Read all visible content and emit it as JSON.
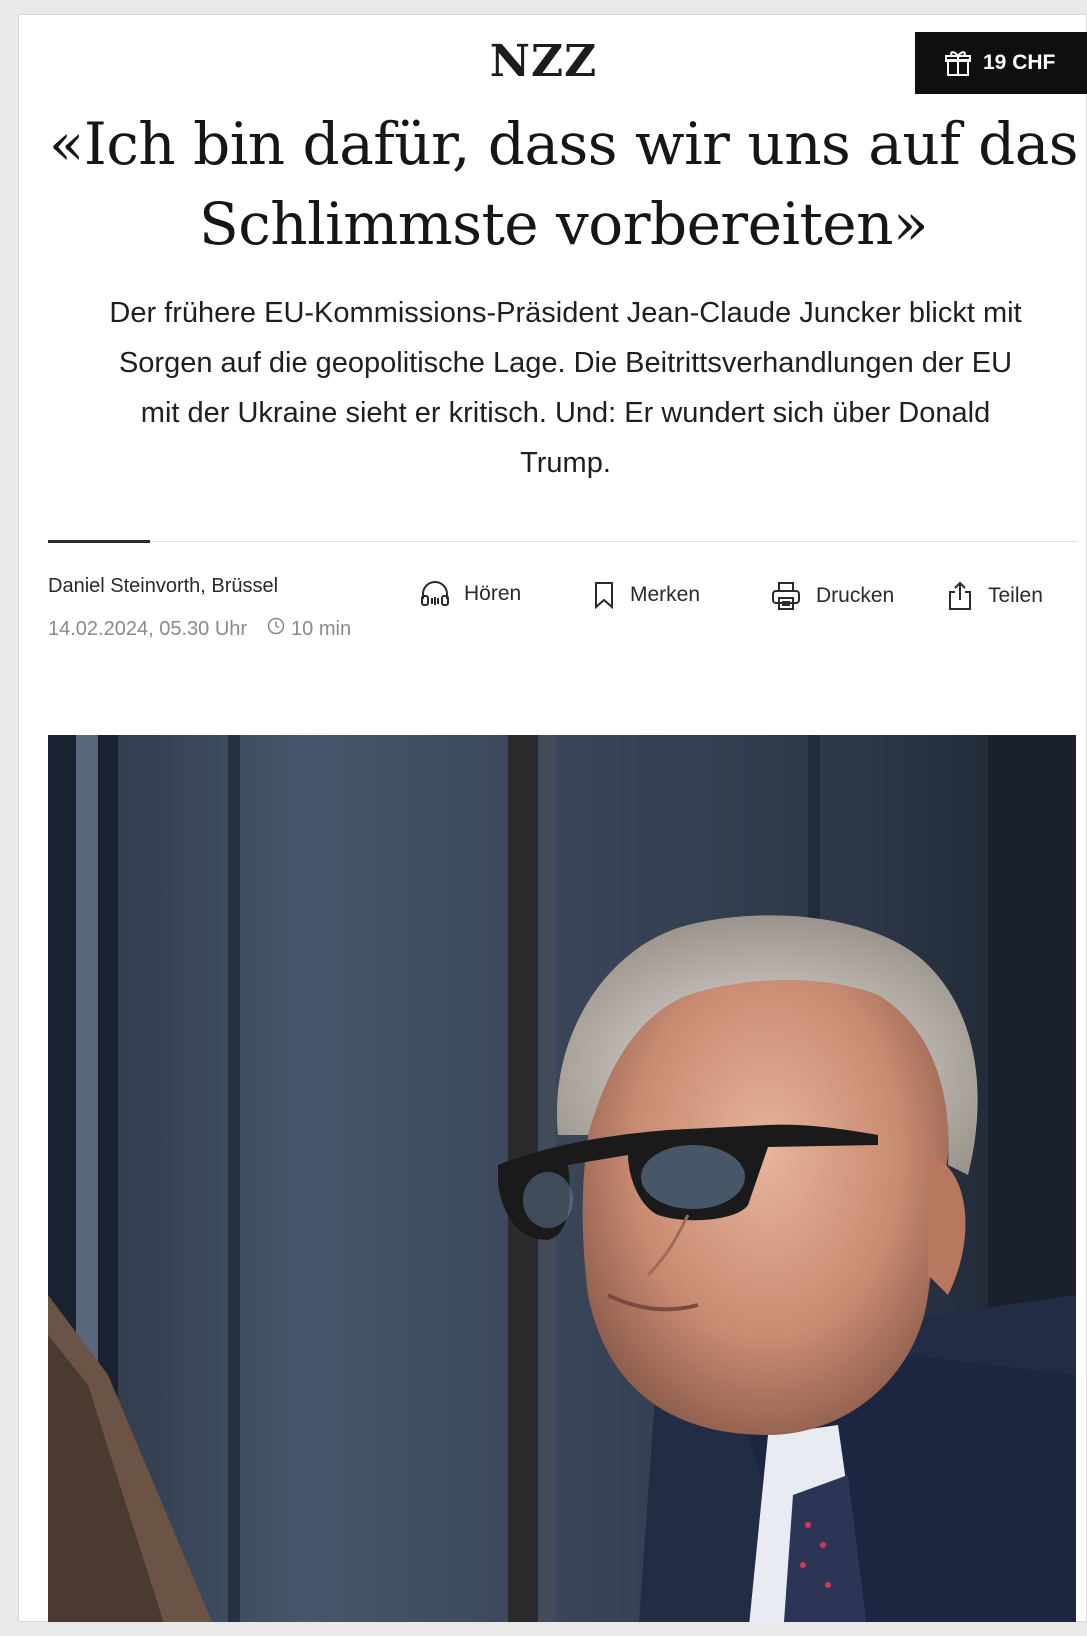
{
  "masthead": {
    "logo": "NZZ",
    "promo_label": "19 CHF"
  },
  "article": {
    "headline_line1": "«Ich bin dafür, dass wir uns auf das",
    "headline_line2": "Schlimmste vorbereiten»",
    "lead_line1": "Der frühere EU-Kommissions-Präsident Jean-Claude Juncker blickt mit",
    "lead_line2": "Sorgen auf die geopolitische Lage. Die Beitrittsverhandlungen der EU",
    "lead_line3": "mit der Ukraine sieht er kritisch. Und: Er wundert sich über Donald",
    "lead_line4": "Trump.",
    "author": "Daniel Steinvorth, Brüssel",
    "date": "14.02.2024, 05.30 Uhr",
    "read_time": "10 min"
  },
  "actions": {
    "listen": "Hören",
    "bookmark": "Merken",
    "print": "Drucken",
    "share": "Teilen"
  },
  "colors": {
    "promo_background": "#0f0f0f",
    "text": "#1c1c1c",
    "meta_text": "#8a8a8a"
  },
  "icons": [
    "gift-icon",
    "headphones-icon",
    "bookmark-icon",
    "printer-icon",
    "share-icon",
    "clock-icon"
  ]
}
